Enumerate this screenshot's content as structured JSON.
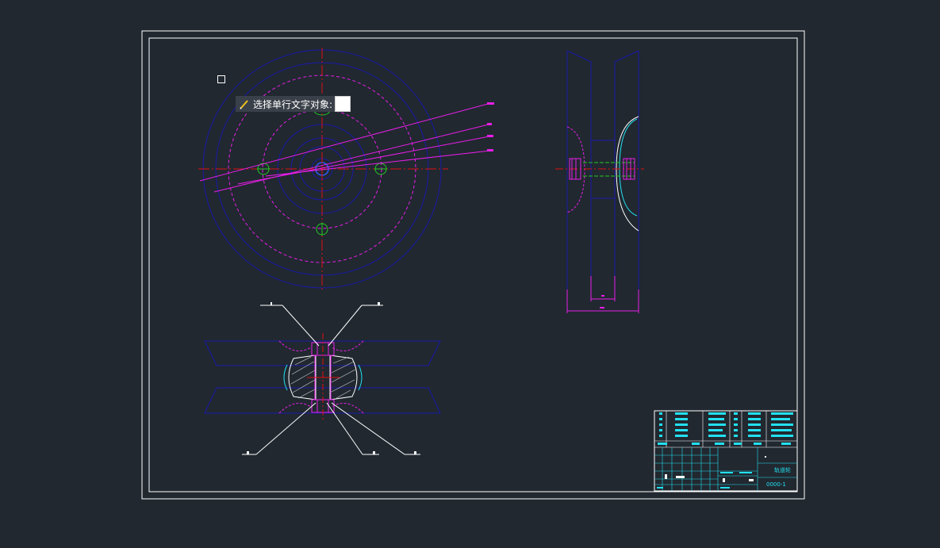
{
  "command_prompt": {
    "icon": "pencil-icon",
    "text": "选择单行文字对象:",
    "input_value": ""
  },
  "drawing": {
    "title_block_name": "轨道轮",
    "title_block_code": "0000-1"
  },
  "colors": {
    "background": "#212830",
    "frame": "#ffffff",
    "outline_blue": "#1a1aa8",
    "magenta": "#e81ee8",
    "red_center": "#e01010",
    "green": "#22cc22",
    "cyan": "#22e0f0"
  }
}
